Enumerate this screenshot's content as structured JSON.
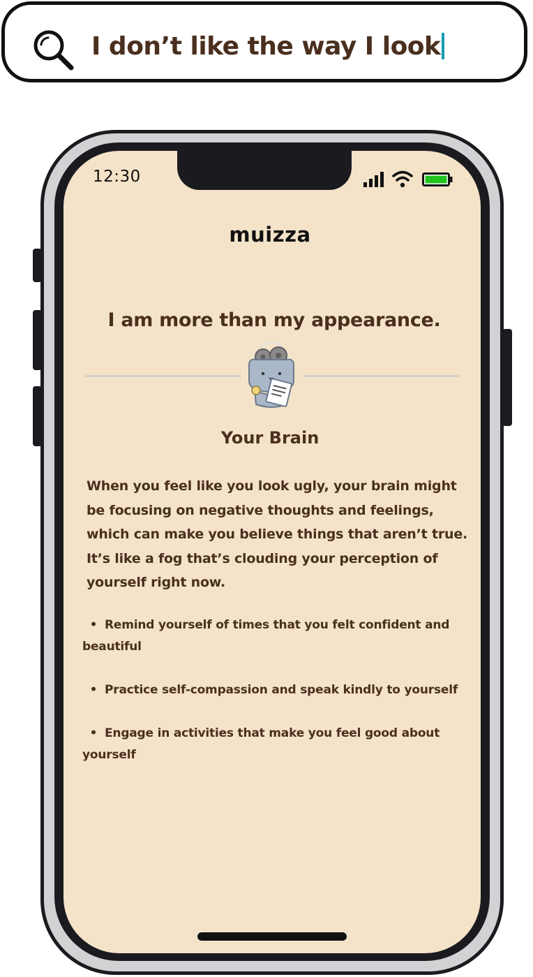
{
  "search": {
    "query": "I don’t like the way I look",
    "icon": "search-icon",
    "caret_color": "#1a9bb5"
  },
  "status_bar": {
    "time": "12:30",
    "icons": [
      "signal-icon",
      "wifi-icon",
      "battery-icon"
    ],
    "battery_color": "#22c31e"
  },
  "app": {
    "title": "muizza"
  },
  "content": {
    "affirmation": "I am more than my appearance.",
    "mascot_icon": "brain-mascot-icon",
    "section_title": "Your Brain",
    "paragraph": "When you feel like you look ugly, your brain might be focusing on negative thoughts and feelings, which can make you believe things that aren’t true. It’s like a fog that’s clouding your perception of yourself right now.",
    "tips": [
      {
        "bullet": "•",
        "text": "Remind yourself of times that you felt confident and beautiful"
      },
      {
        "bullet": "•",
        "text": "Practice self-compassion and speak kindly to yourself"
      },
      {
        "bullet": "•",
        "text": "Engage in activities that make you feel good about yourself"
      }
    ]
  },
  "colors": {
    "screen_background": "#f5e3c9",
    "text_brown": "#4a2f1e",
    "phone_frame": "#1b1b1f"
  }
}
